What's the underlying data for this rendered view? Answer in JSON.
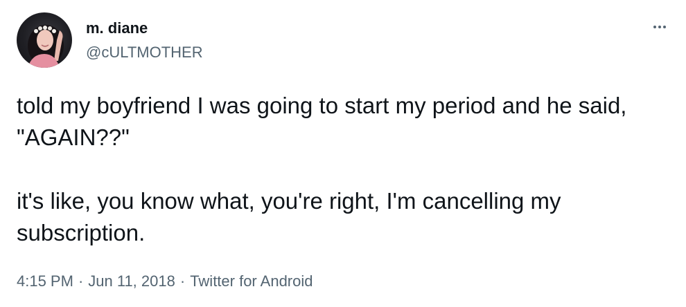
{
  "author": {
    "display_name": "m. diane",
    "handle": "@cULTMOTHER"
  },
  "tweet": {
    "text": "told my boyfriend I was going to start my period and he said, \"AGAIN??\"\n\nit's like, you know what, you're right, I'm cancelling my subscription.",
    "time": "4:15 PM",
    "date": "Jun 11, 2018",
    "source": "Twitter for Android",
    "separator": "·"
  },
  "icons": {
    "more": "more-horizontal-icon"
  }
}
